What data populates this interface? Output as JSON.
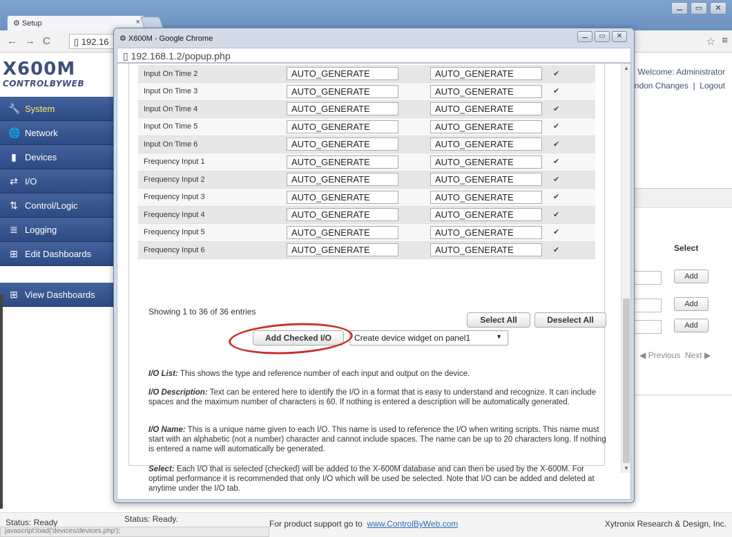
{
  "browser": {
    "tab_title": "Setup",
    "tab_close": "×",
    "url_partial": "192.16",
    "window_controls": [
      "⚊",
      "▭",
      "✕"
    ]
  },
  "site": {
    "logo_line1": "X600M",
    "logo_line2": "CONTROLBYWEB",
    "welcome": "Welcome: Administrator",
    "abandon": "Abandon Changes",
    "logout": "Logout"
  },
  "sidebar": {
    "items": [
      {
        "label": "System",
        "icon": "wrench-icon",
        "glyph": "🔧"
      },
      {
        "label": "Network",
        "icon": "globe-icon",
        "glyph": "🌐"
      },
      {
        "label": "Devices",
        "icon": "device-icon",
        "glyph": "▮"
      },
      {
        "label": "I/O",
        "icon": "io-arrows-icon",
        "glyph": "⇄"
      },
      {
        "label": "Control/Logic",
        "icon": "logic-icon",
        "glyph": "⇅"
      },
      {
        "label": "Logging",
        "icon": "log-icon",
        "glyph": "≣"
      },
      {
        "label": "Edit Dashboards",
        "icon": "dashboard-icon",
        "glyph": "⊞"
      },
      {
        "label": "View Dashboards",
        "icon": "dashboard-icon",
        "glyph": "⊞"
      }
    ]
  },
  "main": {
    "select_header": "Select",
    "add_label": "Add",
    "previous": "Previous",
    "next": "Next"
  },
  "status": {
    "left": "Status:  Ready",
    "js": "javascript:load('devices/devices.php');",
    "support_prefix": "For product support go to",
    "support_link": "www.ControlByWeb.com",
    "company": "Xytronix Research & Design, Inc."
  },
  "popup": {
    "title": "X600M - Google Chrome",
    "url": "192.168.1.2/popup.php",
    "rows": [
      {
        "name": "Input On Time 2",
        "description": "AUTO_GENERATE",
        "io_name": "AUTO_GENERATE",
        "checked": true
      },
      {
        "name": "Input On Time 3",
        "description": "AUTO_GENERATE",
        "io_name": "AUTO_GENERATE",
        "checked": true
      },
      {
        "name": "Input On Time 4",
        "description": "AUTO_GENERATE",
        "io_name": "AUTO_GENERATE",
        "checked": true
      },
      {
        "name": "Input On Time 5",
        "description": "AUTO_GENERATE",
        "io_name": "AUTO_GENERATE",
        "checked": true
      },
      {
        "name": "Input On Time 6",
        "description": "AUTO_GENERATE",
        "io_name": "AUTO_GENERATE",
        "checked": true
      },
      {
        "name": "Frequency Input 1",
        "description": "AUTO_GENERATE",
        "io_name": "AUTO_GENERATE",
        "checked": true
      },
      {
        "name": "Frequency Input 2",
        "description": "AUTO_GENERATE",
        "io_name": "AUTO_GENERATE",
        "checked": true
      },
      {
        "name": "Frequency Input 3",
        "description": "AUTO_GENERATE",
        "io_name": "AUTO_GENERATE",
        "checked": true
      },
      {
        "name": "Frequency Input 4",
        "description": "AUTO_GENERATE",
        "io_name": "AUTO_GENERATE",
        "checked": true
      },
      {
        "name": "Frequency Input 5",
        "description": "AUTO_GENERATE",
        "io_name": "AUTO_GENERATE",
        "checked": true
      },
      {
        "name": "Frequency Input 6",
        "description": "AUTO_GENERATE",
        "io_name": "AUTO_GENERATE",
        "checked": true
      }
    ],
    "showing": "Showing 1 to 36 of 36 entries",
    "select_all": "Select All",
    "deselect_all": "Deselect All",
    "add_checked": "Add Checked I/O",
    "widget_option": "Create device widget on panel1",
    "help": [
      {
        "term": "I/O List:",
        "text": " This shows the type and reference number of each input and output on the device."
      },
      {
        "term": "I/O Description:",
        "text": " Text can be entered here to identify the I/O in a format that is easy to understand and recognize. It can include spaces and the maximum number of characters is 60. If nothing is entered a description will be automatically generated."
      },
      {
        "term": "I/O Name:",
        "text": " This is a unique name given to each I/O. This name is used to reference the I/O when writing scripts. This name must start with an alphabetic (not a number) character and cannot include spaces. The name can be up to 20 characters long. If nothing is entered a name will automatically be generated."
      },
      {
        "term": "Select:",
        "text": " Each I/O that is selected (checked) will be added to the X-600M database and can then be used by the X-600M. For optimal performance it is recommended that only I/O which will be used be selected. Note that I/O can be added and deleted at anytime under the I/O tab."
      }
    ],
    "status": "Status:  Ready."
  },
  "colors": {
    "sidebar": "#2c4a84",
    "sidebar_active_text": "#ffe86a",
    "annotation": "#c9302c"
  }
}
